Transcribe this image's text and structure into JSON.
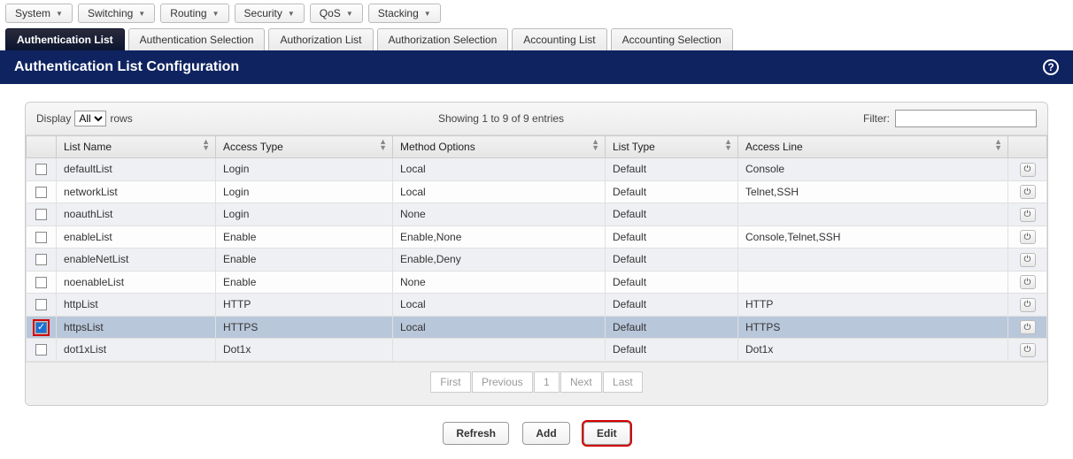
{
  "menus": [
    "System",
    "Switching",
    "Routing",
    "Security",
    "QoS",
    "Stacking"
  ],
  "tabs": [
    {
      "label": "Authentication List",
      "active": true
    },
    {
      "label": "Authentication Selection",
      "active": false
    },
    {
      "label": "Authorization List",
      "active": false
    },
    {
      "label": "Authorization Selection",
      "active": false
    },
    {
      "label": "Accounting List",
      "active": false
    },
    {
      "label": "Accounting Selection",
      "active": false
    }
  ],
  "page_title": "Authentication List Configuration",
  "toolbar": {
    "display_label": "Display",
    "display_value": "All",
    "rows_label": "rows",
    "showing_text": "Showing 1 to 9 of 9 entries",
    "filter_label": "Filter:",
    "filter_value": ""
  },
  "columns": [
    "",
    "List Name",
    "Access Type",
    "Method Options",
    "List Type",
    "Access Line",
    ""
  ],
  "rows": [
    {
      "checked": false,
      "highlight": false,
      "selected": false,
      "name": "defaultList",
      "access": "Login",
      "method": "Local",
      "type": "Default",
      "line": "Console"
    },
    {
      "checked": false,
      "highlight": false,
      "selected": false,
      "name": "networkList",
      "access": "Login",
      "method": "Local",
      "type": "Default",
      "line": "Telnet,SSH"
    },
    {
      "checked": false,
      "highlight": false,
      "selected": false,
      "name": "noauthList",
      "access": "Login",
      "method": "None",
      "type": "Default",
      "line": ""
    },
    {
      "checked": false,
      "highlight": false,
      "selected": false,
      "name": "enableList",
      "access": "Enable",
      "method": "Enable,None",
      "type": "Default",
      "line": "Console,Telnet,SSH"
    },
    {
      "checked": false,
      "highlight": false,
      "selected": false,
      "name": "enableNetList",
      "access": "Enable",
      "method": "Enable,Deny",
      "type": "Default",
      "line": ""
    },
    {
      "checked": false,
      "highlight": false,
      "selected": false,
      "name": "noenableList",
      "access": "Enable",
      "method": "None",
      "type": "Default",
      "line": ""
    },
    {
      "checked": false,
      "highlight": false,
      "selected": false,
      "name": "httpList",
      "access": "HTTP",
      "method": "Local",
      "type": "Default",
      "line": "HTTP"
    },
    {
      "checked": true,
      "highlight": true,
      "selected": true,
      "name": "httpsList",
      "access": "HTTPS",
      "method": "Local",
      "type": "Default",
      "line": "HTTPS"
    },
    {
      "checked": false,
      "highlight": false,
      "selected": false,
      "name": "dot1xList",
      "access": "Dot1x",
      "method": "",
      "type": "Default",
      "line": "Dot1x"
    }
  ],
  "pager": {
    "first": "First",
    "prev": "Previous",
    "page": "1",
    "next": "Next",
    "last": "Last"
  },
  "buttons": {
    "refresh": "Refresh",
    "add": "Add",
    "edit": "Edit"
  }
}
